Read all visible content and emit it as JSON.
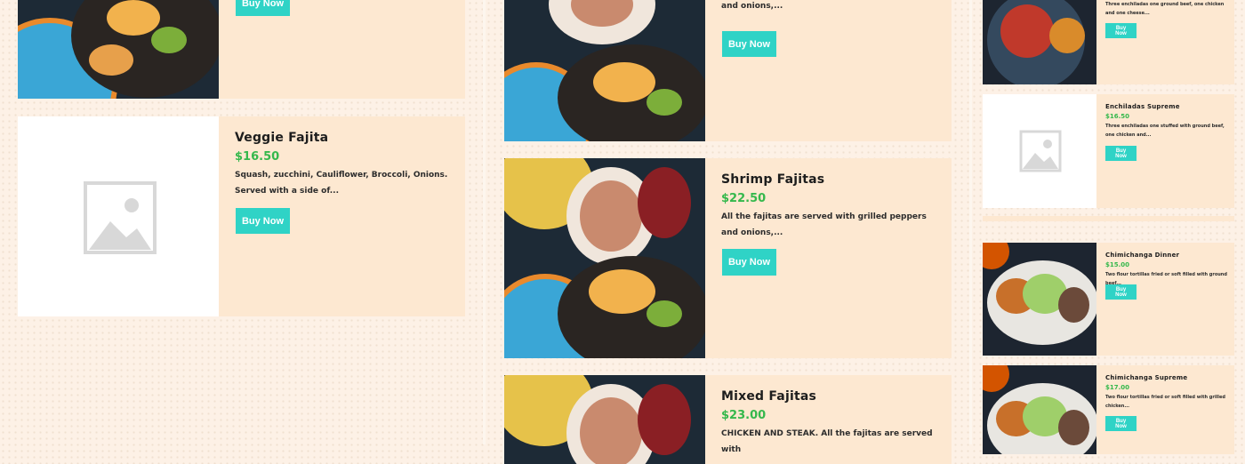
{
  "buy_label": "Buy Now",
  "colors": {
    "accent": "#2fd3c6",
    "price": "#35b84c",
    "card_bg": "#fde8d1"
  },
  "col1": [
    {
      "image": "fajita-photo",
      "title": "",
      "price": "",
      "desc": ""
    },
    {
      "image": "placeholder",
      "title": "Veggie Fajita",
      "price": "$16.50",
      "desc": "Squash, zucchini, Cauliflower, Broccoli, Onions. Served with a side of..."
    }
  ],
  "col2": [
    {
      "image": "fajita-photo",
      "desc": "All the fajitas are served with grilled peppers and onions,..."
    },
    {
      "image": "fajita-photo",
      "title": "Shrimp Fajitas",
      "price": "$22.50",
      "desc": "All the fajitas are served with grilled peppers and onions,..."
    },
    {
      "image": "fajita-photo",
      "title": "Mixed Fajitas",
      "price": "$23.00",
      "desc": "CHICKEN AND STEAK. All the fajitas are served with"
    }
  ],
  "col3": [
    {
      "image": "enchilada-photo",
      "desc": "Three enchiladas one ground beef, one chicken and one cheese..."
    },
    {
      "image": "placeholder",
      "title": "Enchiladas Supreme",
      "price": "$16.50",
      "desc": "Three enchiladas one stuffed with ground beef, one chicken and..."
    },
    {
      "image": "chimichanga-photo",
      "title": "Chimichanga Dinner",
      "price": "$15.00",
      "desc": "Two flour tortillas fried or soft filled with ground beef..."
    },
    {
      "image": "chimichanga-photo",
      "title": "Chimichanga Supreme",
      "price": "$17.00",
      "desc": "Two flour tortillas fried or soft filled with grilled chicken..."
    }
  ]
}
